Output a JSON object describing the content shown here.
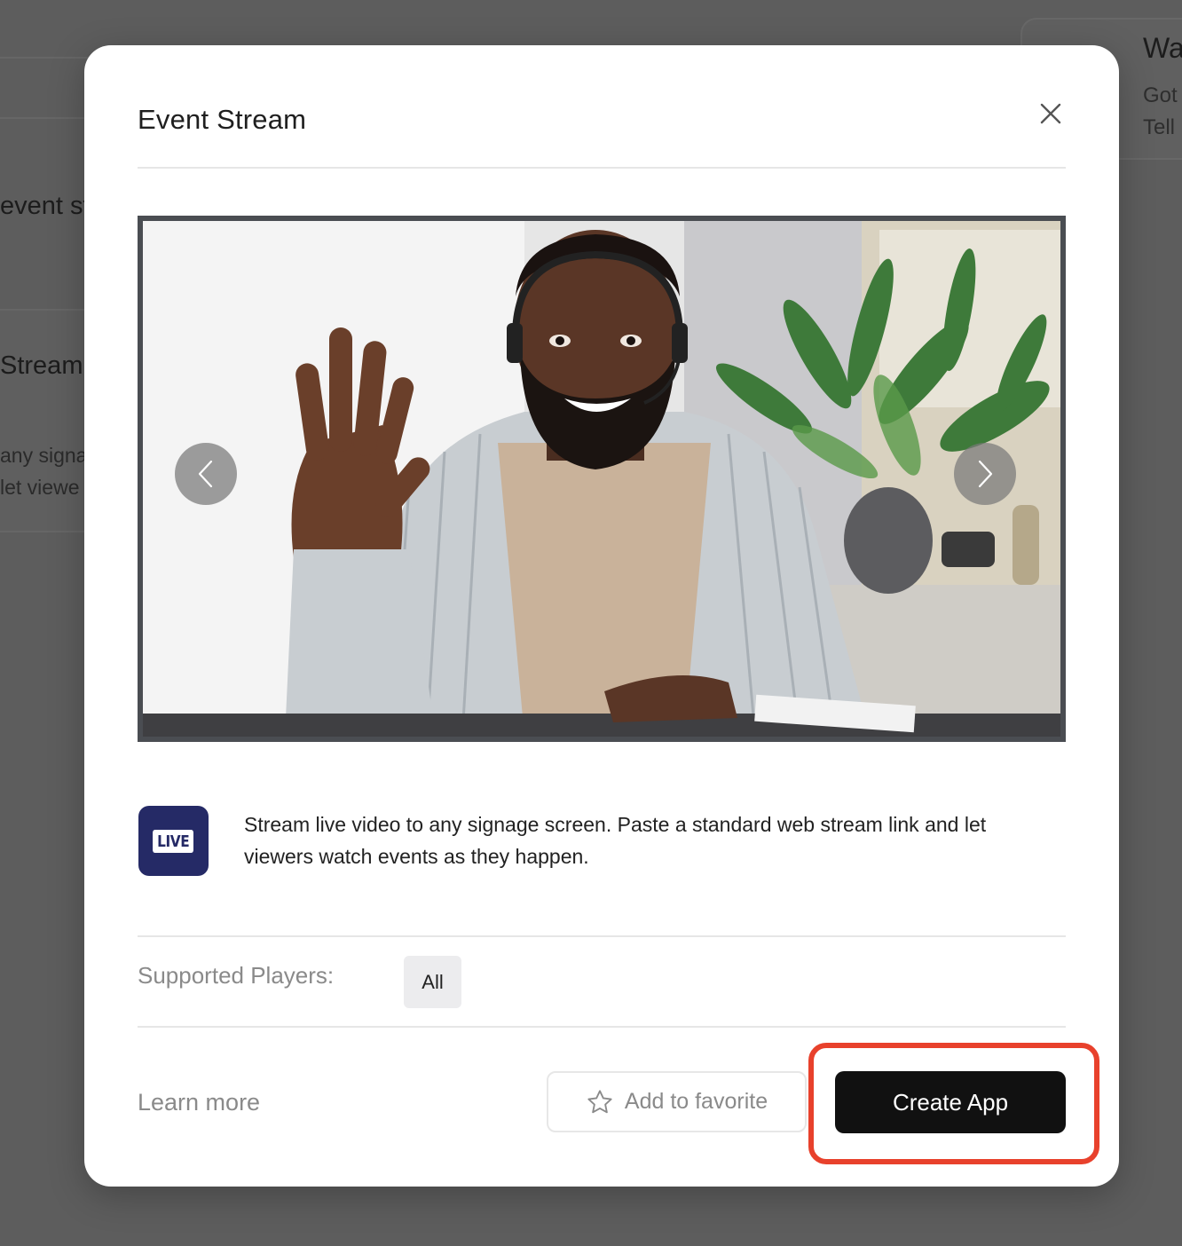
{
  "background": {
    "left_texts": [
      "event st",
      "Stream",
      "any signa",
      "let viewe"
    ],
    "right_texts": [
      "Wa",
      "Got",
      "Tell"
    ]
  },
  "modal": {
    "title": "Event Stream",
    "close_icon": "close-icon",
    "carousel": {
      "prev_icon": "chevron-left-icon",
      "next_icon": "chevron-right-icon",
      "image_alt": "Smiling man with headset waving at camera"
    },
    "app": {
      "icon_label": "LIVE",
      "description": "Stream live video to any signage screen. Paste a standard web stream link and let viewers watch events as they happen."
    },
    "supported_players": {
      "label": "Supported Players:",
      "values": [
        "All"
      ]
    },
    "footer": {
      "learn_more": "Learn more",
      "favorite_label": "Add to favorite",
      "favorite_icon": "star-icon",
      "create_label": "Create App"
    }
  },
  "colors": {
    "overlay": "#5d5d5d",
    "app_icon_bg": "#252a66",
    "primary_button": "#111111",
    "highlight": "#e8412c"
  }
}
